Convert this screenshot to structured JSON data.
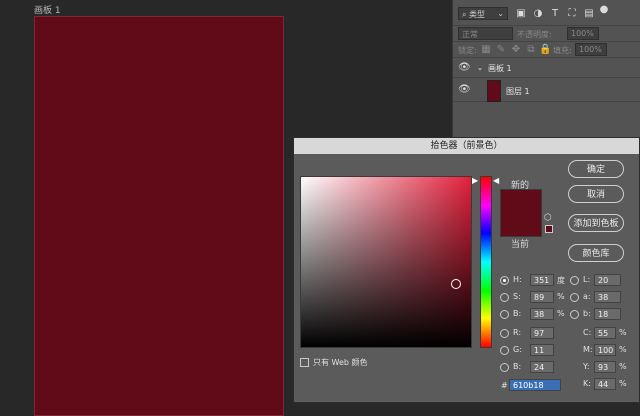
{
  "canvas": {
    "artboard_label": "画板 1"
  },
  "layers": {
    "filter_kind": "类型",
    "blend_mode": "正常",
    "opacity_label": "不透明度:",
    "opacity_value": "100%",
    "lock_label": "锁定:",
    "fill_label": "填充:",
    "fill_value": "100%",
    "group_name": "画板 1",
    "layer_name": "图层 1"
  },
  "picker": {
    "title": "拾色器（前景色）",
    "new_label": "新的",
    "current_label": "当前",
    "buttons": {
      "ok": "确定",
      "cancel": "取消",
      "add_to_swatches": "添加到色板",
      "color_libraries": "颜色库"
    },
    "web_only_label": "只有 Web 颜色",
    "hsb": {
      "h": "351",
      "s": "89",
      "b": "38",
      "h_unit": "度",
      "pct": "%"
    },
    "rgb": {
      "r": "97",
      "g": "11",
      "b": "24"
    },
    "lab": {
      "l": "20",
      "a": "38",
      "b": "18"
    },
    "cmyk": {
      "c": "55",
      "m": "100",
      "y": "93",
      "k": "44"
    },
    "hex_prefix": "#",
    "hex": "610b18",
    "labels": {
      "H": "H:",
      "S": "S:",
      "B": "B:",
      "R": "R:",
      "G": "G:",
      "Bb": "B:",
      "L": "L:",
      "a": "a:",
      "b": "b:",
      "C": "C:",
      "M": "M:",
      "Y": "Y:",
      "K": "K:"
    }
  },
  "colors": {
    "foreground": "#610b18",
    "current": "#610b18"
  }
}
